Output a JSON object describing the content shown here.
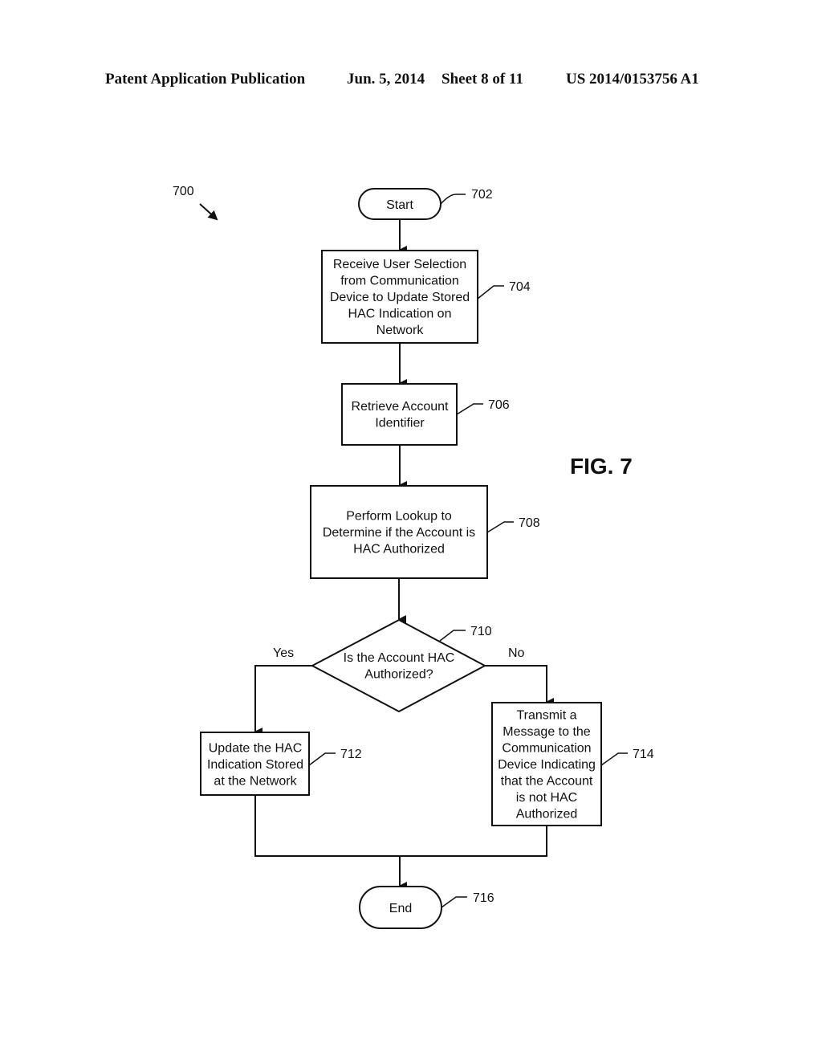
{
  "header": {
    "publication": "Patent Application Publication",
    "date": "Jun. 5, 2014",
    "sheet": "Sheet 8 of 11",
    "number": "US 2014/0153756 A1"
  },
  "figure": {
    "label": "FIG. 7",
    "ref": "700"
  },
  "nodes": {
    "start": {
      "ref": "702",
      "lines": [
        "Start"
      ]
    },
    "n704": {
      "ref": "704",
      "lines": [
        "Receive User Selection",
        "from Communication",
        "Device to Update Stored",
        "HAC Indication on",
        "Network"
      ]
    },
    "n706": {
      "ref": "706",
      "lines": [
        "Retrieve Account",
        "Identifier"
      ]
    },
    "n708": {
      "ref": "708",
      "lines": [
        "Perform Lookup to",
        "Determine if the Account is",
        "HAC Authorized"
      ]
    },
    "n710": {
      "ref": "710",
      "lines": [
        "Is the Account HAC",
        "Authorized?"
      ]
    },
    "n712": {
      "ref": "712",
      "lines": [
        "Update the HAC",
        "Indication Stored",
        "at the Network"
      ]
    },
    "n714": {
      "ref": "714",
      "lines": [
        "Transmit a",
        "Message to the",
        "Communication",
        "Device Indicating",
        "that the Account",
        "is not HAC",
        "Authorized"
      ]
    },
    "end": {
      "ref": "716",
      "lines": [
        "End"
      ]
    }
  },
  "branches": {
    "yes": "Yes",
    "no": "No"
  }
}
